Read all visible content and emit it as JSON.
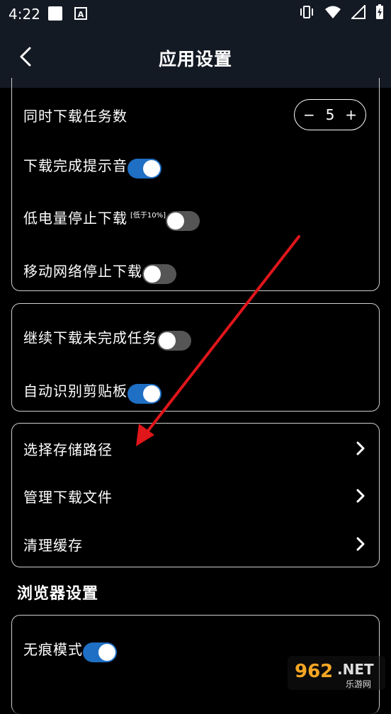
{
  "status_bar": {
    "time": "4:22"
  },
  "header": {
    "title": "应用设置"
  },
  "download_group": {
    "concurrent_tasks": {
      "label": "同时下载任务数",
      "value": "5",
      "minus": "−",
      "plus": "+"
    },
    "complete_sound": {
      "label": "下载完成提示音",
      "on": true
    },
    "low_battery": {
      "label": "低电量停止下载",
      "note": "[低于10%]",
      "on": false
    },
    "mobile_network": {
      "label": "移动网络停止下载",
      "on": false
    }
  },
  "resume_group": {
    "continue_tasks": {
      "label": "继续下载未完成任务",
      "on": false
    },
    "clipboard": {
      "label": "自动识别剪贴板",
      "on": true
    }
  },
  "storage_group": {
    "storage_path": {
      "label": "选择存储路径"
    },
    "manage_files": {
      "label": "管理下载文件"
    },
    "clear_cache": {
      "label": "清理缓存"
    }
  },
  "browser_section": {
    "title": "浏览器设置",
    "incognito": {
      "label": "无痕模式",
      "on": true
    }
  },
  "watermark": {
    "brand": "962",
    "suffix": ".NET",
    "site": "乐游网"
  },
  "colors": {
    "accent": "#1f6fc4",
    "annotation": "#e0161b",
    "header_bg": "#141a24"
  }
}
